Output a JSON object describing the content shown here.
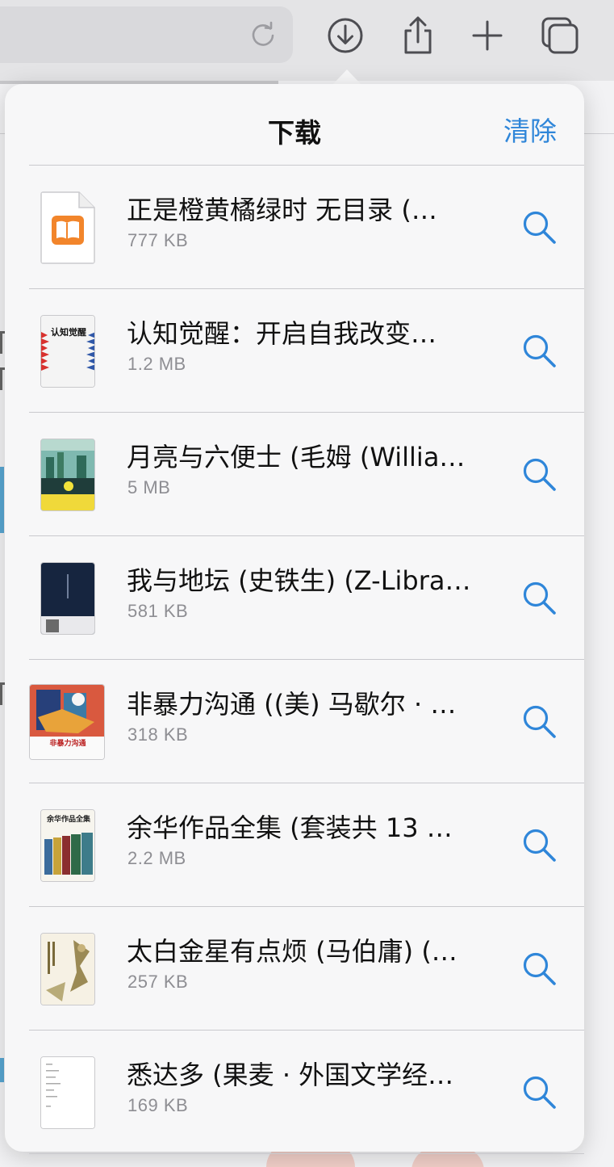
{
  "toolbar": {
    "icons": [
      "reload-icon",
      "downloads-icon",
      "share-icon",
      "new-tab-icon",
      "tabs-icon"
    ]
  },
  "downloads": {
    "title": "下载",
    "clear_label": "清除",
    "accent_color": "#2f86d9",
    "items": [
      {
        "title": "正是橙黄橘绿时 无目录 (…",
        "size": "777 KB",
        "thumbnail": "books-app-icon"
      },
      {
        "title": "认知觉醒：开启自我改变…",
        "size": "1.2 MB",
        "thumbnail": "book-cover",
        "cover_text": "认知觉醒"
      },
      {
        "title": "月亮与六便士 (毛姆 (Willia…",
        "size": "5 MB",
        "thumbnail": "book-cover"
      },
      {
        "title": "我与地坛 (史铁生) (Z-Libra…",
        "size": "581 KB",
        "thumbnail": "book-cover"
      },
      {
        "title": "非暴力沟通 ((美) 马歇尔 · …",
        "size": "318 KB",
        "thumbnail": "book-cover",
        "cover_text": "非暴力沟通"
      },
      {
        "title": "余华作品全集 (套装共 13 …",
        "size": "2.2 MB",
        "thumbnail": "book-cover",
        "cover_text": "余华作品全集"
      },
      {
        "title": "太白金星有点烦 (马伯庸) (…",
        "size": "257 KB",
        "thumbnail": "book-cover"
      },
      {
        "title": "悉达多 (果麦 · 外国文学经…",
        "size": "169 KB",
        "thumbnail": "book-cover"
      }
    ]
  }
}
